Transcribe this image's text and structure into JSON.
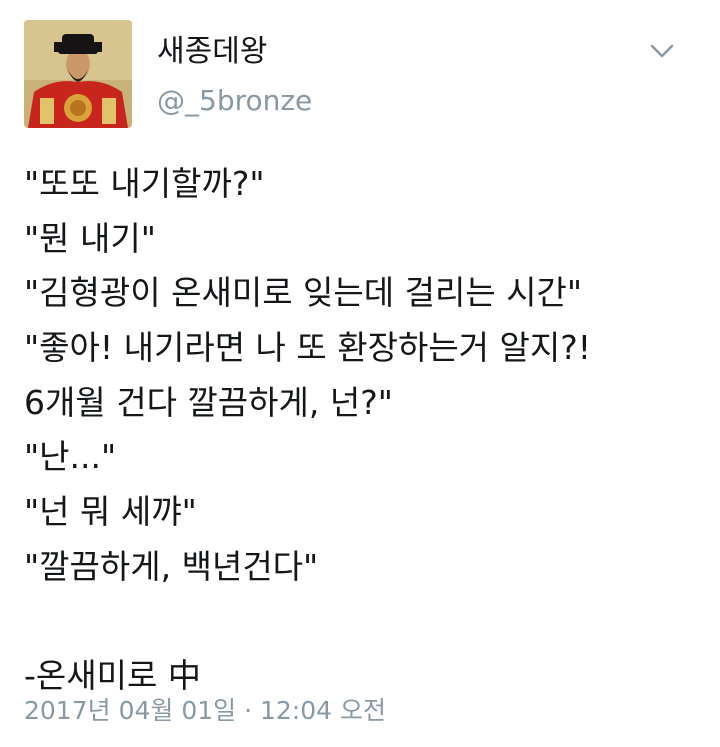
{
  "user": {
    "display_name": "새종데왕",
    "handle": "@_5bronze",
    "avatar_icon": "king-portrait-avatar"
  },
  "menu_icon": "chevron-down-icon",
  "tweet": {
    "lines": [
      "\"또또 내기할까?\"",
      "\"뭔 내기\"",
      "\"김형광이 온새미로 잊는데 걸리는 시간\"",
      "\"좋아! 내기라면 나 또 환장하는거 알지?!",
      "6개월 건다 깔끔하게, 넌?\"",
      "\"난...\"",
      "\"넌 뭐 세꺄\"",
      "\"깔끔하게, 백년건다\"",
      "",
      "-온새미로 中"
    ],
    "timestamp": "2017년 04월 01일 · 12:04 오전"
  },
  "colors": {
    "text_primary": "#14171a",
    "text_secondary": "#8899a6",
    "background": "#ffffff"
  }
}
